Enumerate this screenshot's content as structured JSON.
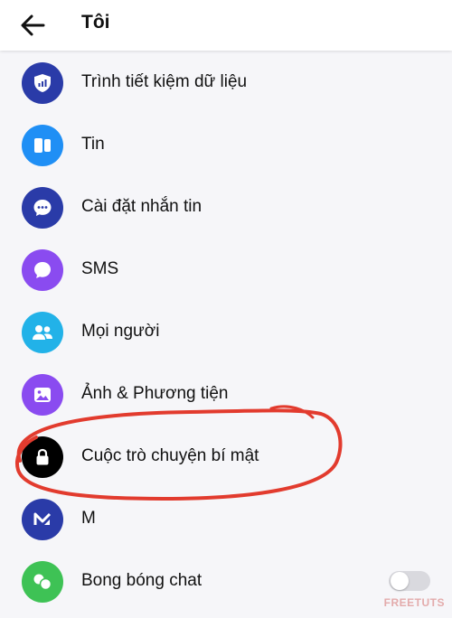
{
  "header": {
    "title": "Tôi",
    "back_icon": "arrow-left-icon"
  },
  "menu": {
    "items": [
      {
        "id": "data-saver",
        "label": "Trình tiết kiệm dữ liệu",
        "icon": "shield-signal-icon",
        "color": "#2a3ba8"
      },
      {
        "id": "stories",
        "label": "Tin",
        "icon": "stories-icon",
        "color": "#1f8ff5"
      },
      {
        "id": "message-settings",
        "label": "Cài đặt nhắn tin",
        "icon": "chat-bubble-icon",
        "color": "#2a3ba8"
      },
      {
        "id": "sms",
        "label": "SMS",
        "icon": "sms-icon",
        "color": "#8a4bf0"
      },
      {
        "id": "people",
        "label": "Mọi người",
        "icon": "people-icon",
        "color": "#22b2e8"
      },
      {
        "id": "photos-media",
        "label": "Ảnh & Phương tiện",
        "icon": "photo-icon",
        "color": "#8a4bf0"
      },
      {
        "id": "secret-conversations",
        "label": "Cuộc trò chuyện bí mật",
        "icon": "lock-icon",
        "color": "#000000"
      },
      {
        "id": "m",
        "label": "M",
        "icon": "m-assistant-icon",
        "color": "#2a3ba8"
      },
      {
        "id": "chat-heads",
        "label": "Bong bóng chat",
        "icon": "chat-heads-icon",
        "color": "#3ec255"
      }
    ]
  },
  "chat_heads_toggle": {
    "on": false
  },
  "annotation_color": "#e23b2e",
  "watermark": "FREETUTS"
}
